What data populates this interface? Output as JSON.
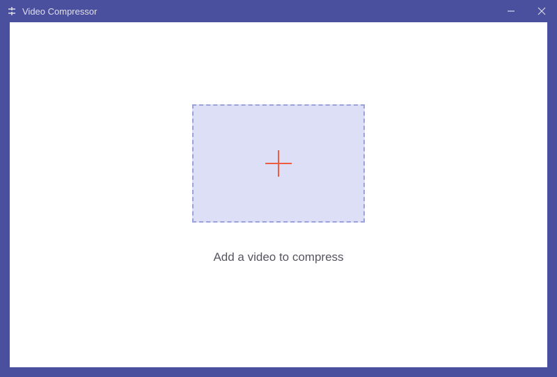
{
  "titlebar": {
    "title": "Video Compressor"
  },
  "main": {
    "instruction": "Add a video to compress"
  },
  "colors": {
    "frame": "#4a4f9e",
    "dropzone_bg": "#dcdff6",
    "dropzone_border": "#9aa0d8",
    "plus": "#ee5b3f"
  }
}
